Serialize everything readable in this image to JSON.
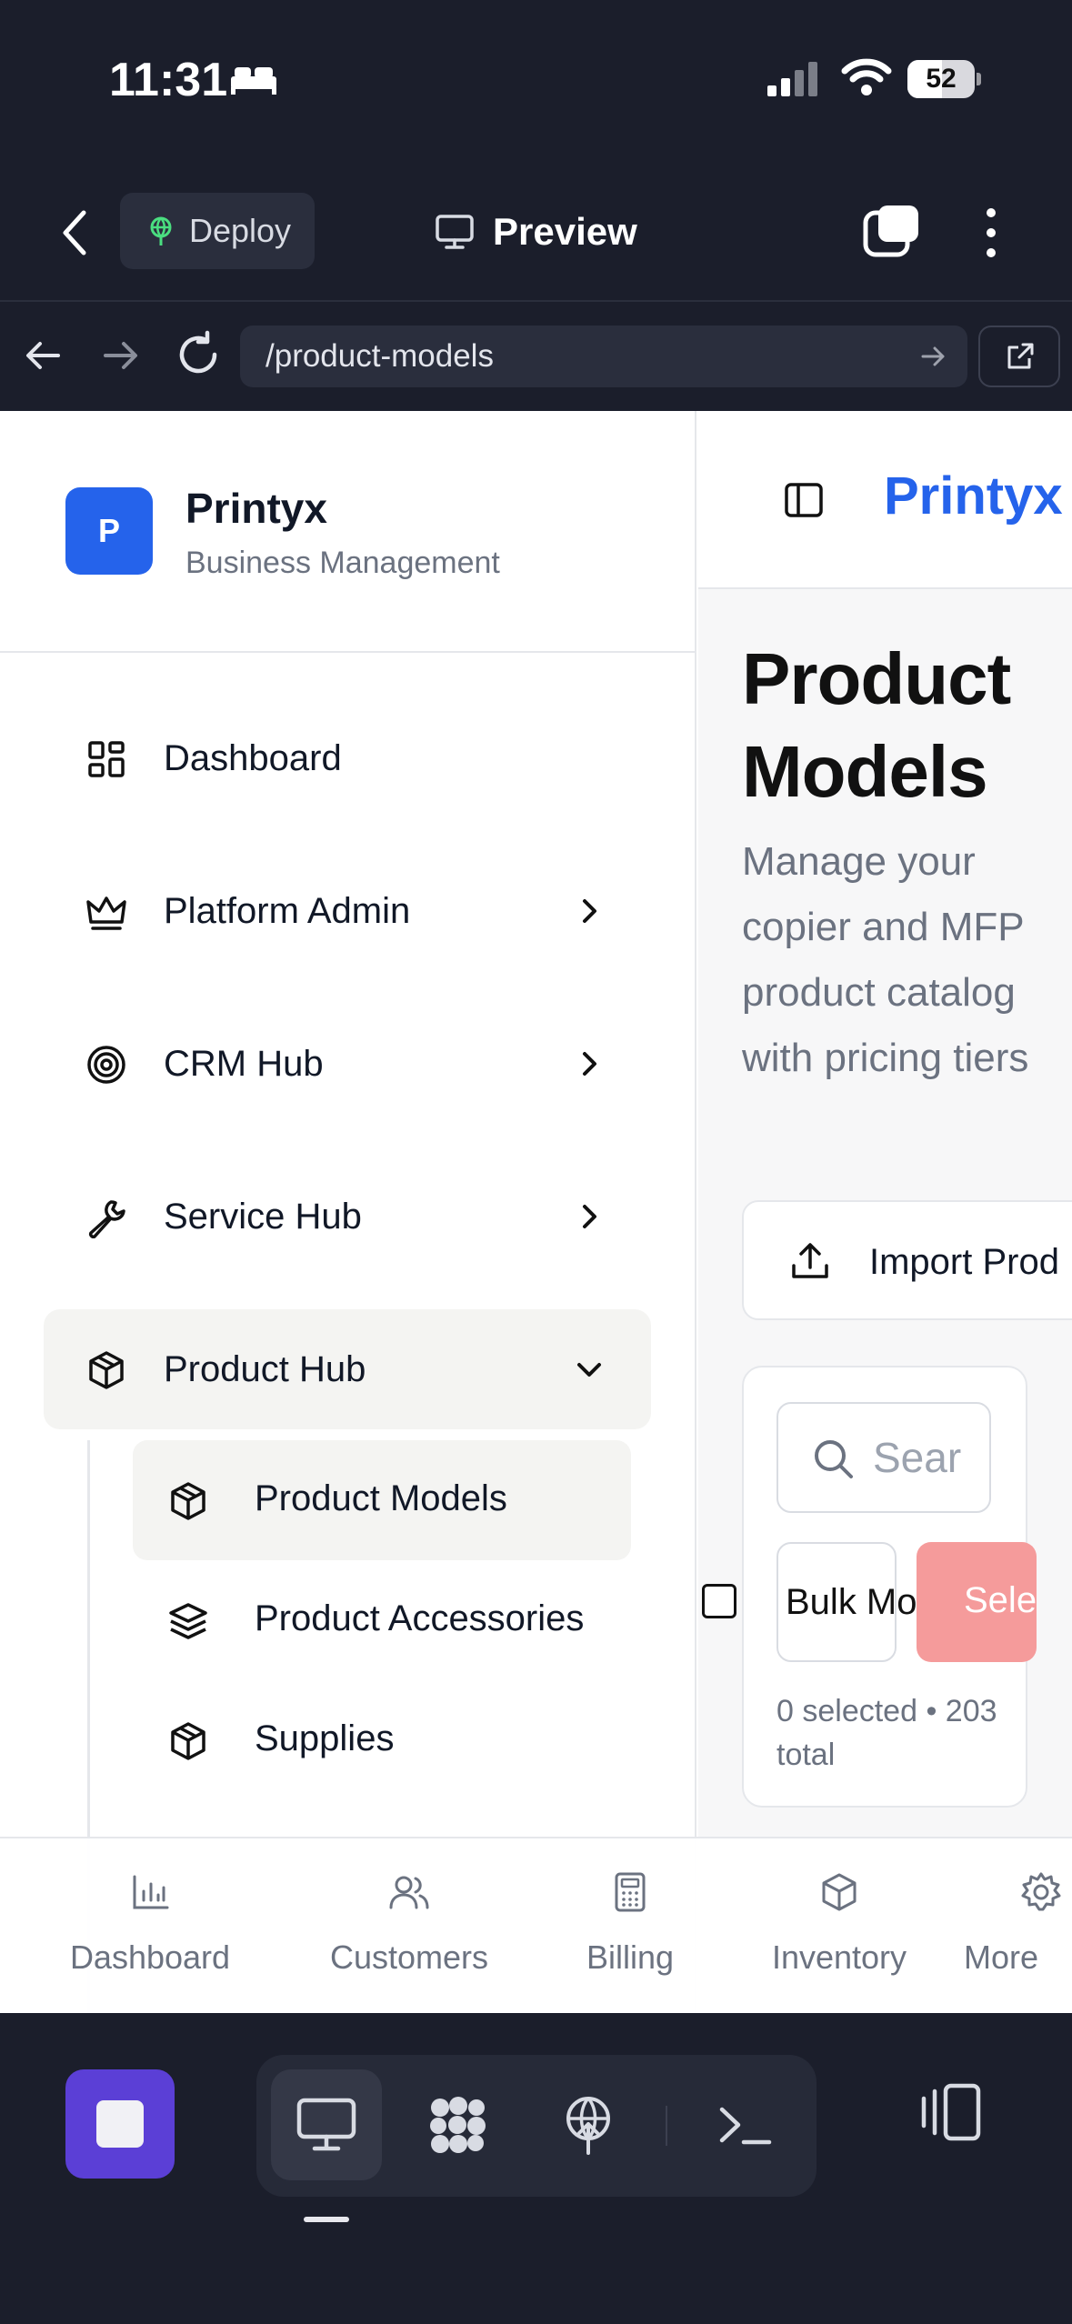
{
  "status_bar": {
    "time": "11:31",
    "battery": "52",
    "battery_level": 0.52
  },
  "app_bar": {
    "deploy_label": "Deploy",
    "preview_label": "Preview"
  },
  "url_bar": {
    "url": "/product-models"
  },
  "sidebar": {
    "brand_initial": "P",
    "brand_name": "Printyx",
    "brand_subtitle": "Business Management",
    "items": [
      {
        "label": "Dashboard",
        "icon": "dashboard-icon"
      },
      {
        "label": "Platform Admin",
        "icon": "crown-icon"
      },
      {
        "label": "CRM Hub",
        "icon": "target-icon"
      },
      {
        "label": "Service Hub",
        "icon": "wrench-icon"
      },
      {
        "label": "Product Hub",
        "icon": "box-icon"
      }
    ],
    "sub_items": [
      {
        "label": "Product Models",
        "icon": "box-icon"
      },
      {
        "label": "Product Accessories",
        "icon": "layers-icon"
      },
      {
        "label": "Supplies",
        "icon": "box-icon"
      }
    ]
  },
  "main": {
    "brand": "Printyx",
    "title": "Product Models",
    "description": "Manage your copier and MFP product catalog with pricing tiers",
    "import_label": "Import Prod",
    "search_placeholder": "Sear",
    "bulk_label": "Bulk Mode",
    "delete_label": "Sele",
    "selection_summary": "0 selected • 203 total"
  },
  "tab_bar": {
    "items": [
      {
        "label": "Dashboard",
        "icon": "bar-chart-icon"
      },
      {
        "label": "Customers",
        "icon": "users-icon"
      },
      {
        "label": "Billing",
        "icon": "calculator-icon"
      },
      {
        "label": "Inventory",
        "icon": "box-icon"
      },
      {
        "label": "More",
        "icon": "gear-icon"
      }
    ]
  },
  "colors": {
    "accent": "#2563eb",
    "chrome_bg": "#1b1e2b",
    "stop_button": "#5b3fd6",
    "danger_soft": "#f59b9b"
  }
}
